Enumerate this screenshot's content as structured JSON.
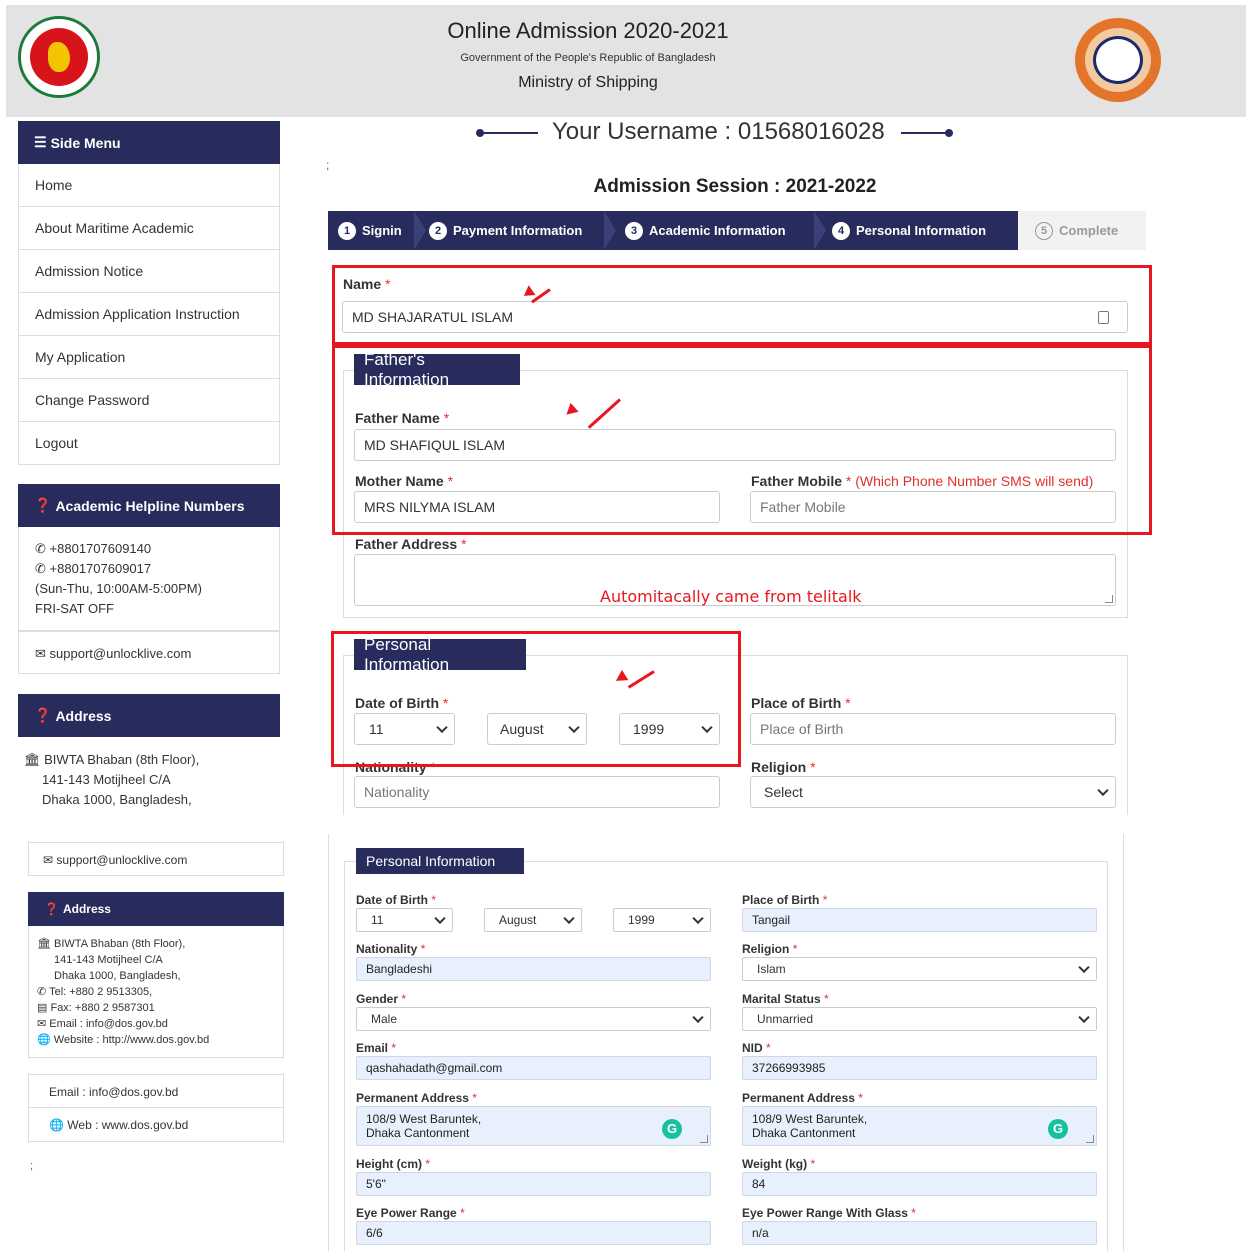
{
  "header": {
    "title": "Online Admission 2020-2021",
    "government": "Government of the People's Republic of Bangladesh",
    "ministry": "Ministry of Shipping"
  },
  "sidebar": {
    "menu_title": "Side Menu",
    "items": [
      {
        "label": "Home"
      },
      {
        "label": "About Maritime Academic"
      },
      {
        "label": "Admission Notice"
      },
      {
        "label": "Admission Application Instruction"
      },
      {
        "label": "My Application"
      },
      {
        "label": "Change Password"
      },
      {
        "label": "Logout"
      }
    ],
    "helpline_title": "Academic Helpline Numbers",
    "phone1": "+8801707609140",
    "phone2": "+8801707609017",
    "hours": "(Sun-Thu, 10:00AM-5:00PM)",
    "off": "FRI-SAT OFF",
    "support_email": "support@unlocklive.com",
    "address_title": "Address",
    "address_line1": "BIWTA Bhaban (8th Floor),",
    "address_line2": "141-143 Motijheel C/A",
    "address_line3": "Dhaka 1000, Bangladesh,"
  },
  "main": {
    "semicolon": ";",
    "username_label": "Your Username : 01568016028",
    "session": "Admission Session : 2021-2022",
    "steps": [
      {
        "num": "1",
        "label": "Signin"
      },
      {
        "num": "2",
        "label": "Payment Information"
      },
      {
        "num": "3",
        "label": "Academic Information"
      },
      {
        "num": "4",
        "label": "Personal Information"
      },
      {
        "num": "5",
        "label": "Complete"
      }
    ],
    "name_label": "Name",
    "name_value": "MD SHAJARATUL ISLAM",
    "required_mark": "*",
    "father_legend": "Father's Information",
    "father_name_label": "Father Name",
    "father_name_value": "MD SHAFIQUL ISLAM",
    "mother_name_label": "Mother Name",
    "mother_name_value": "MRS  NILYMA  ISLAM",
    "father_mobile_label": "Father Mobile",
    "father_mobile_note": "(Which Phone Number SMS will send)",
    "father_mobile_placeholder": "Father Mobile",
    "father_address_label": "Father Address",
    "annotation": "Automitacally came from telitalk",
    "personal_legend": "Personal Information",
    "dob_label": "Date of Birth",
    "dob_day": "11",
    "dob_month": "August",
    "dob_year": "1999",
    "pob_label": "Place of Birth",
    "pob_placeholder": "Place of Birth",
    "nationality_label": "Nationality",
    "nationality_placeholder": "Nationality",
    "religion_label": "Religion",
    "religion_value": "Select"
  },
  "lower_sidebar": {
    "support_email": "support@unlocklive.com",
    "address_title": "Address",
    "address_lines": [
      "BIWTA Bhaban (8th Floor),",
      "141-143 Motijheel C/A",
      "Dhaka 1000, Bangladesh,"
    ],
    "tel": "Tel: +880 2 9513305,",
    "fax": "Fax: +880 2 9587301",
    "email": "Email : info@dos.gov.bd",
    "website": "Website : http://www.dos.gov.bd",
    "email_link": "Email : info@dos.gov.bd",
    "web_link": "Web : www.dos.gov.bd",
    "semicolon": ";"
  },
  "lower_form": {
    "legend": "Personal Information",
    "dob_label": "Date of Birth",
    "dob_day": "11",
    "dob_month": "August",
    "dob_year": "1999",
    "pob_label": "Place of Birth",
    "pob_value": "Tangail",
    "nationality_label": "Nationality",
    "nationality_value": "Bangladeshi",
    "religion_label": "Religion",
    "religion_value": "Islam",
    "gender_label": "Gender",
    "gender_value": "Male",
    "marital_label": "Marital Status",
    "marital_value": "Unmarried",
    "email_label": "Email",
    "email_value": "qashahadath@gmail.com",
    "nid_label": "NID",
    "nid_value": "37266993985",
    "perm_addr_label": "Permanent Address",
    "perm_addr_line1": "108/9 West Baruntek,",
    "perm_addr_line2": "Dhaka Cantonment",
    "perm_addr2_label": "Permanent Address",
    "perm_addr2_line1": "108/9 West Baruntek,",
    "perm_addr2_line2": "Dhaka Cantonment",
    "height_label": "Height (cm)",
    "height_value": "5'6\"",
    "weight_label": "Weight (kg)",
    "weight_value": "84",
    "eye_label": "Eye Power Range",
    "eye_value": "6/6",
    "eye_glass_label": "Eye Power Range With Glass",
    "eye_glass_value": "n/a",
    "grammarly_glyph": "G"
  },
  "colors": {
    "navy": "#272c5c",
    "red_annotation": "#e8161f",
    "required": "#e03131",
    "autofill": "#e8f0fe"
  }
}
